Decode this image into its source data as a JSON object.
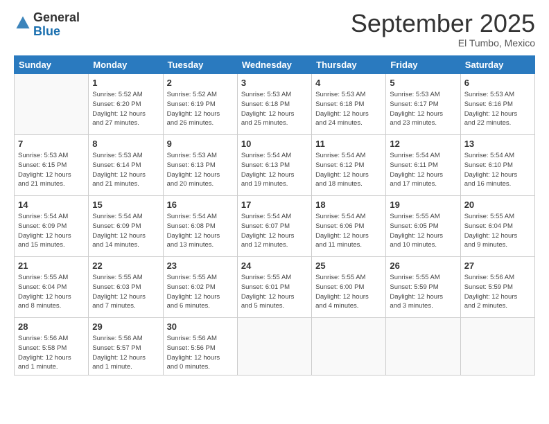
{
  "header": {
    "logo_general": "General",
    "logo_blue": "Blue",
    "month_title": "September 2025",
    "location": "El Tumbo, Mexico"
  },
  "days_of_week": [
    "Sunday",
    "Monday",
    "Tuesday",
    "Wednesday",
    "Thursday",
    "Friday",
    "Saturday"
  ],
  "weeks": [
    [
      {
        "day": "",
        "info": ""
      },
      {
        "day": "1",
        "info": "Sunrise: 5:52 AM\nSunset: 6:20 PM\nDaylight: 12 hours\nand 27 minutes."
      },
      {
        "day": "2",
        "info": "Sunrise: 5:52 AM\nSunset: 6:19 PM\nDaylight: 12 hours\nand 26 minutes."
      },
      {
        "day": "3",
        "info": "Sunrise: 5:53 AM\nSunset: 6:18 PM\nDaylight: 12 hours\nand 25 minutes."
      },
      {
        "day": "4",
        "info": "Sunrise: 5:53 AM\nSunset: 6:18 PM\nDaylight: 12 hours\nand 24 minutes."
      },
      {
        "day": "5",
        "info": "Sunrise: 5:53 AM\nSunset: 6:17 PM\nDaylight: 12 hours\nand 23 minutes."
      },
      {
        "day": "6",
        "info": "Sunrise: 5:53 AM\nSunset: 6:16 PM\nDaylight: 12 hours\nand 22 minutes."
      }
    ],
    [
      {
        "day": "7",
        "info": "Sunrise: 5:53 AM\nSunset: 6:15 PM\nDaylight: 12 hours\nand 21 minutes."
      },
      {
        "day": "8",
        "info": "Sunrise: 5:53 AM\nSunset: 6:14 PM\nDaylight: 12 hours\nand 21 minutes."
      },
      {
        "day": "9",
        "info": "Sunrise: 5:53 AM\nSunset: 6:13 PM\nDaylight: 12 hours\nand 20 minutes."
      },
      {
        "day": "10",
        "info": "Sunrise: 5:54 AM\nSunset: 6:13 PM\nDaylight: 12 hours\nand 19 minutes."
      },
      {
        "day": "11",
        "info": "Sunrise: 5:54 AM\nSunset: 6:12 PM\nDaylight: 12 hours\nand 18 minutes."
      },
      {
        "day": "12",
        "info": "Sunrise: 5:54 AM\nSunset: 6:11 PM\nDaylight: 12 hours\nand 17 minutes."
      },
      {
        "day": "13",
        "info": "Sunrise: 5:54 AM\nSunset: 6:10 PM\nDaylight: 12 hours\nand 16 minutes."
      }
    ],
    [
      {
        "day": "14",
        "info": "Sunrise: 5:54 AM\nSunset: 6:09 PM\nDaylight: 12 hours\nand 15 minutes."
      },
      {
        "day": "15",
        "info": "Sunrise: 5:54 AM\nSunset: 6:09 PM\nDaylight: 12 hours\nand 14 minutes."
      },
      {
        "day": "16",
        "info": "Sunrise: 5:54 AM\nSunset: 6:08 PM\nDaylight: 12 hours\nand 13 minutes."
      },
      {
        "day": "17",
        "info": "Sunrise: 5:54 AM\nSunset: 6:07 PM\nDaylight: 12 hours\nand 12 minutes."
      },
      {
        "day": "18",
        "info": "Sunrise: 5:54 AM\nSunset: 6:06 PM\nDaylight: 12 hours\nand 11 minutes."
      },
      {
        "day": "19",
        "info": "Sunrise: 5:55 AM\nSunset: 6:05 PM\nDaylight: 12 hours\nand 10 minutes."
      },
      {
        "day": "20",
        "info": "Sunrise: 5:55 AM\nSunset: 6:04 PM\nDaylight: 12 hours\nand 9 minutes."
      }
    ],
    [
      {
        "day": "21",
        "info": "Sunrise: 5:55 AM\nSunset: 6:04 PM\nDaylight: 12 hours\nand 8 minutes."
      },
      {
        "day": "22",
        "info": "Sunrise: 5:55 AM\nSunset: 6:03 PM\nDaylight: 12 hours\nand 7 minutes."
      },
      {
        "day": "23",
        "info": "Sunrise: 5:55 AM\nSunset: 6:02 PM\nDaylight: 12 hours\nand 6 minutes."
      },
      {
        "day": "24",
        "info": "Sunrise: 5:55 AM\nSunset: 6:01 PM\nDaylight: 12 hours\nand 5 minutes."
      },
      {
        "day": "25",
        "info": "Sunrise: 5:55 AM\nSunset: 6:00 PM\nDaylight: 12 hours\nand 4 minutes."
      },
      {
        "day": "26",
        "info": "Sunrise: 5:55 AM\nSunset: 5:59 PM\nDaylight: 12 hours\nand 3 minutes."
      },
      {
        "day": "27",
        "info": "Sunrise: 5:56 AM\nSunset: 5:59 PM\nDaylight: 12 hours\nand 2 minutes."
      }
    ],
    [
      {
        "day": "28",
        "info": "Sunrise: 5:56 AM\nSunset: 5:58 PM\nDaylight: 12 hours\nand 1 minute."
      },
      {
        "day": "29",
        "info": "Sunrise: 5:56 AM\nSunset: 5:57 PM\nDaylight: 12 hours\nand 1 minute."
      },
      {
        "day": "30",
        "info": "Sunrise: 5:56 AM\nSunset: 5:56 PM\nDaylight: 12 hours\nand 0 minutes."
      },
      {
        "day": "",
        "info": ""
      },
      {
        "day": "",
        "info": ""
      },
      {
        "day": "",
        "info": ""
      },
      {
        "day": "",
        "info": ""
      }
    ]
  ]
}
